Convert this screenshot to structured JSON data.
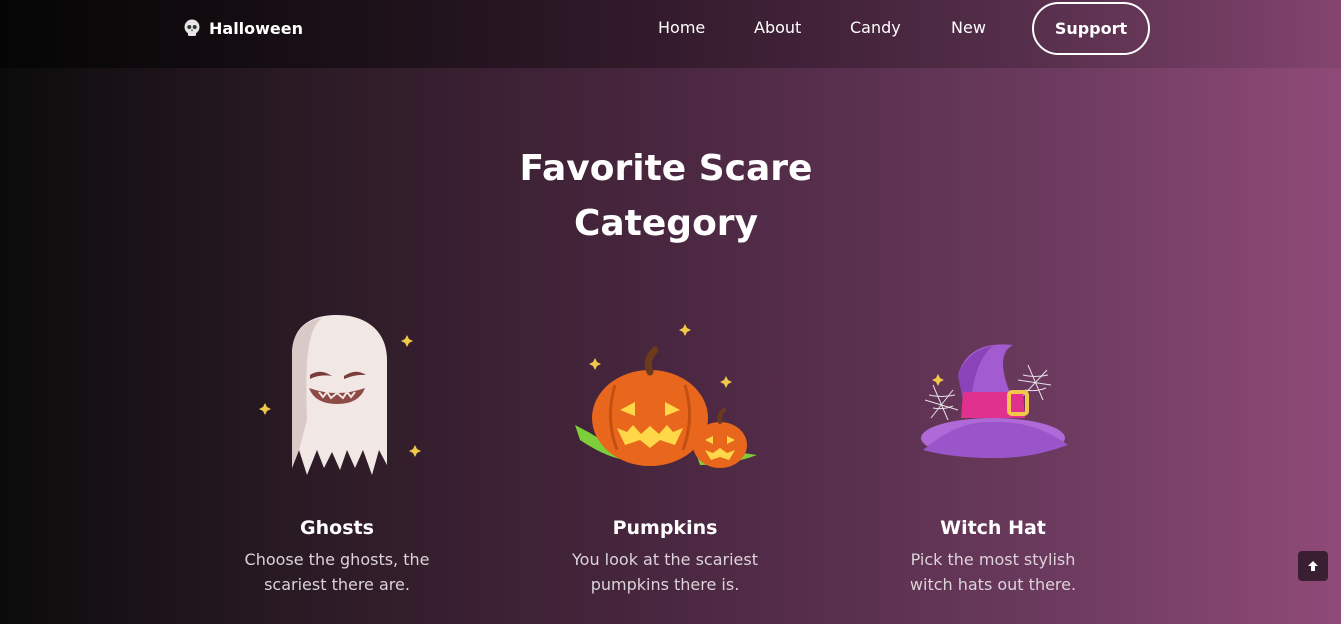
{
  "header": {
    "brand": "Halloween",
    "nav": [
      {
        "label": "Home"
      },
      {
        "label": "About"
      },
      {
        "label": "Candy"
      },
      {
        "label": "New"
      }
    ],
    "support_label": "Support"
  },
  "hero": {
    "title_line1": "Favorite Scare",
    "title_line2": "Category"
  },
  "cards": [
    {
      "title": "Ghosts",
      "desc": "Choose the ghosts, the scariest there are.",
      "icon": "ghost-icon"
    },
    {
      "title": "Pumpkins",
      "desc": "You look at the scariest pumpkins there is.",
      "icon": "pumpkin-icon"
    },
    {
      "title": "Witch Hat",
      "desc": "Pick the most stylish witch hats out there.",
      "icon": "witch-hat-icon"
    }
  ],
  "colors": {
    "accent_pink": "#e0318f",
    "witch_purple": "#a35bd0",
    "pumpkin_orange": "#e8671c"
  }
}
